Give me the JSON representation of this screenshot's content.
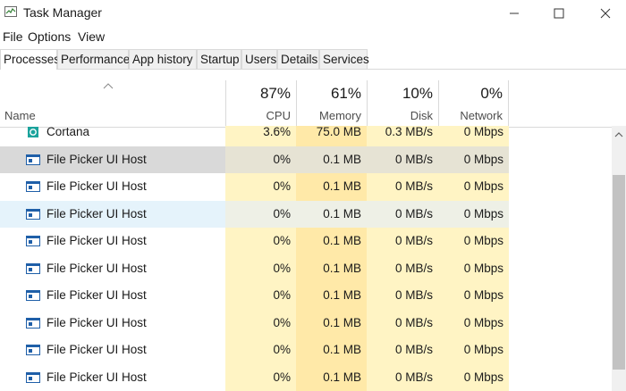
{
  "window": {
    "title": "Task Manager",
    "icon": "task-manager-icon"
  },
  "menu": [
    "File",
    "Options",
    "View"
  ],
  "tabs": [
    "Processes",
    "Performance",
    "App history",
    "Startup",
    "Users",
    "Details",
    "Services"
  ],
  "active_tab": "Processes",
  "columns": {
    "name": "Name",
    "cpu": {
      "label": "CPU",
      "percent": "87%"
    },
    "memory": {
      "label": "Memory",
      "percent": "61%"
    },
    "disk": {
      "label": "Disk",
      "percent": "10%"
    },
    "network": {
      "label": "Network",
      "percent": "0%"
    }
  },
  "rows": [
    {
      "name": "Cortana",
      "icon": "cortana-icon",
      "cpu": "3.6%",
      "memory": "75.0 MB",
      "disk": "0.3 MB/s",
      "network": "0 Mbps"
    },
    {
      "name": "File Picker UI Host",
      "icon": "app-window-icon",
      "cpu": "0%",
      "memory": "0.1 MB",
      "disk": "0 MB/s",
      "network": "0 Mbps",
      "state": "selected"
    },
    {
      "name": "File Picker UI Host",
      "icon": "app-window-icon",
      "cpu": "0%",
      "memory": "0.1 MB",
      "disk": "0 MB/s",
      "network": "0 Mbps"
    },
    {
      "name": "File Picker UI Host",
      "icon": "app-window-icon",
      "cpu": "0%",
      "memory": "0.1 MB",
      "disk": "0 MB/s",
      "network": "0 Mbps",
      "state": "hover"
    },
    {
      "name": "File Picker UI Host",
      "icon": "app-window-icon",
      "cpu": "0%",
      "memory": "0.1 MB",
      "disk": "0 MB/s",
      "network": "0 Mbps"
    },
    {
      "name": "File Picker UI Host",
      "icon": "app-window-icon",
      "cpu": "0%",
      "memory": "0.1 MB",
      "disk": "0 MB/s",
      "network": "0 Mbps"
    },
    {
      "name": "File Picker UI Host",
      "icon": "app-window-icon",
      "cpu": "0%",
      "memory": "0.1 MB",
      "disk": "0 MB/s",
      "network": "0 Mbps"
    },
    {
      "name": "File Picker UI Host",
      "icon": "app-window-icon",
      "cpu": "0%",
      "memory": "0.1 MB",
      "disk": "0 MB/s",
      "network": "0 Mbps"
    },
    {
      "name": "File Picker UI Host",
      "icon": "app-window-icon",
      "cpu": "0%",
      "memory": "0.1 MB",
      "disk": "0 MB/s",
      "network": "0 Mbps"
    },
    {
      "name": "File Picker UI Host",
      "icon": "app-window-icon",
      "cpu": "0%",
      "memory": "0.1 MB",
      "disk": "0 MB/s",
      "network": "0 Mbps"
    }
  ],
  "colors": {
    "usage_light": "#fff4c4",
    "usage_medium": "#ffe9a8",
    "selected": "#d9d9d9",
    "hover": "#e5f3fb",
    "cortana_accent": "#1ba39c",
    "app_icon_blue": "#1f5fa8"
  }
}
